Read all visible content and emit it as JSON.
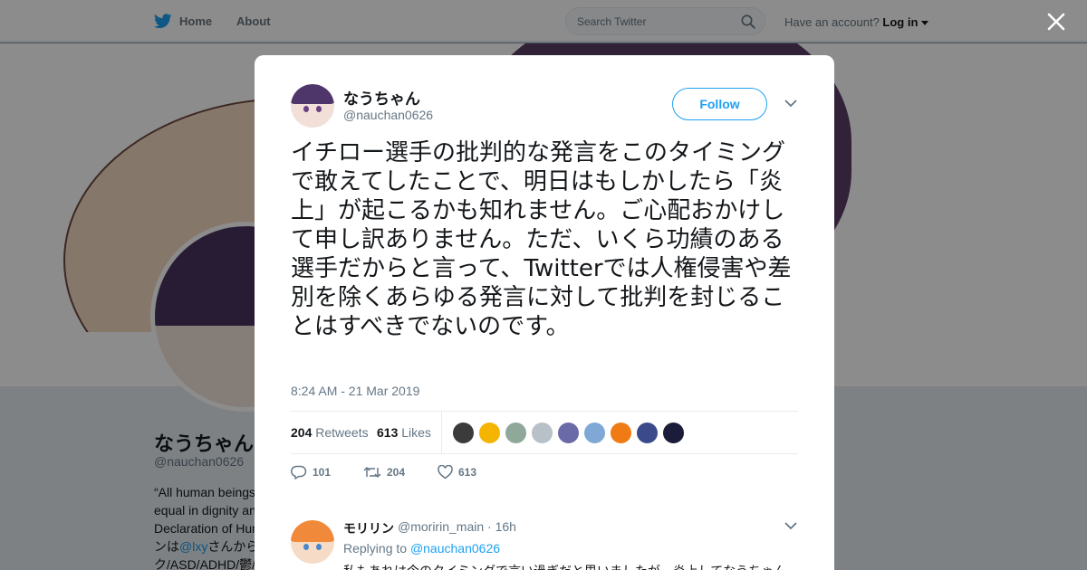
{
  "nav": {
    "home_label": "Home",
    "about_label": "About",
    "search_placeholder": "Search Twitter",
    "have_account": "Have an account?",
    "login_label": "Log in"
  },
  "background_profile": {
    "name": "なうちゃん",
    "handle": "@nauchan0626",
    "bio_lines": [
      "“All human beings",
      "equal in dignity an",
      "Declaration of Hum",
      "ンは",
      "@lxy",
      "さんから",
      "ク/ASD/ADHD/鬱/"
    ]
  },
  "tweet": {
    "author_name": "なうちゃん",
    "author_handle": "@nauchan0626",
    "follow_label": "Follow",
    "text": "イチロー選手の批判的な発言をこのタイミングで敢えてしたことで、明日はもしかしたら「炎上」が起こるかも知れません。ご心配おかけして申し訳ありません。ただ、いくら功績のある選手だからと言って、Twitterでは人権侵害や差別を除くあらゆる発言に対して批判を封じることはすべきでないのです。",
    "timestamp": "8:24 AM - 21 Mar 2019",
    "retweets_count": "204",
    "retweets_label": "Retweets",
    "likes_count": "613",
    "likes_label": "Likes",
    "reply_count": "101",
    "retweet_action_count": "204",
    "like_action_count": "613",
    "liker_avatar_colors": [
      "#3b3b3b",
      "#f5b400",
      "#8fa89a",
      "#b8c0c8",
      "#6a6aa8",
      "#7fa8d6",
      "#f07a14",
      "#3b4a8a",
      "#1b1b3a"
    ]
  },
  "reply": {
    "name": "モリリン",
    "handle": "@moririn_main",
    "time": "· 16h",
    "replying_prefix": "Replying to",
    "replying_to": "@nauchan0626",
    "text": "私もあれは今のタイミングで言い過ぎだと思いましたが、炎上してなうちゃん"
  },
  "colors": {
    "accent": "#1da1f2",
    "twitter_blue": "#1da1f2",
    "muted_text": "#657786"
  }
}
